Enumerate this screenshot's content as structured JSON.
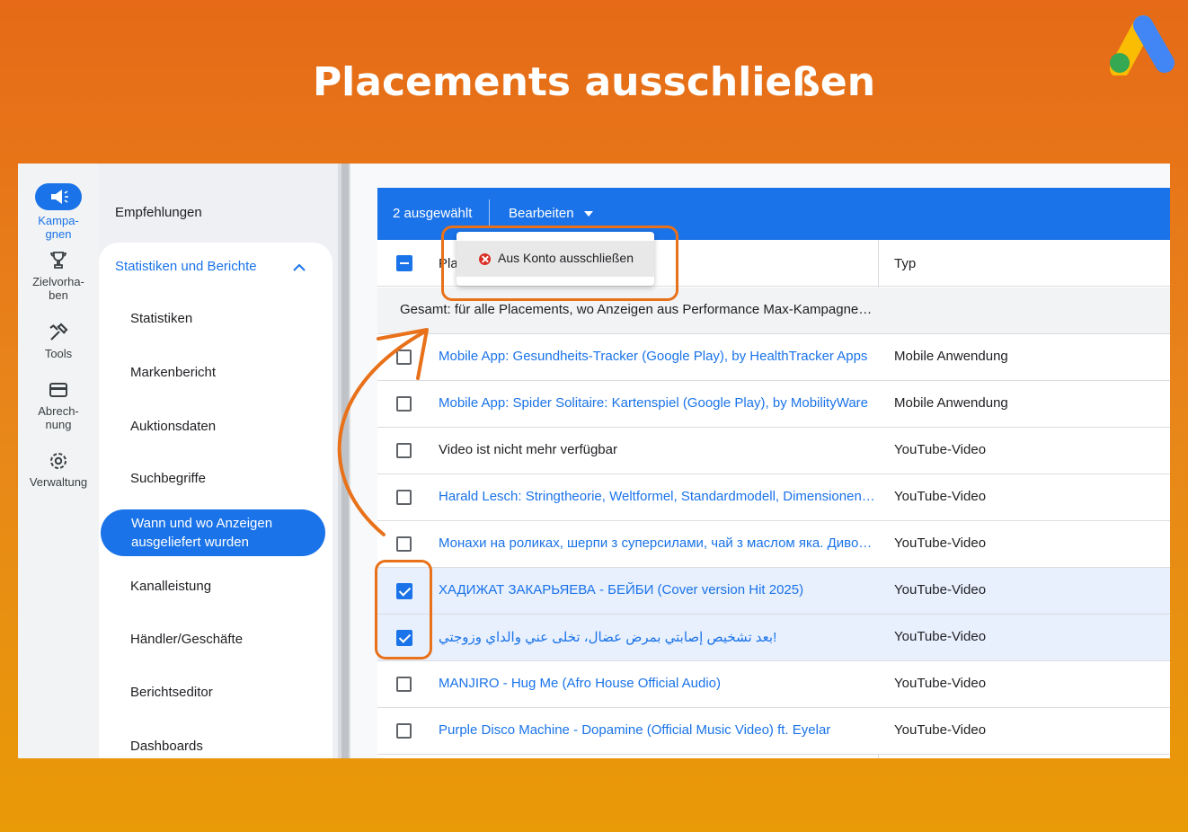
{
  "page_title": "Placements ausschließen",
  "brand_colors": {
    "primary": "#1a73e8",
    "accent_orange": "#e8711a"
  },
  "rail": [
    {
      "label": "Kampa-\ngnen",
      "icon": "megaphone-icon",
      "active": true
    },
    {
      "label": "Zielvorha-\nben",
      "icon": "trophy-icon",
      "active": false
    },
    {
      "label": "Tools",
      "icon": "tools-icon",
      "active": false
    },
    {
      "label": "Abrech-\nnung",
      "icon": "credit-card-icon",
      "active": false
    },
    {
      "label": "Verwaltung",
      "icon": "gear-icon",
      "active": false
    }
  ],
  "nav": {
    "top_item": "Empfehlungen",
    "section": "Statistiken und Berichte",
    "items": [
      "Statistiken",
      "Markenbericht",
      "Auktionsdaten",
      "Suchbegriffe",
      "Wann und wo Anzeigen ausgeliefert wurden",
      "Kanalleistung",
      "Händler/Geschäfte",
      "Berichtseditor",
      "Dashboards"
    ],
    "active_item": "Wann und wo Anzeigen ausgeliefert wurden"
  },
  "toolbar": {
    "selected_count": "2 ausgewählt",
    "edit_label": "Bearbeiten"
  },
  "menu": {
    "item_label": "Aus Konto ausschließen",
    "item_icon": "exclude-icon"
  },
  "table": {
    "header_placement": "Pla",
    "header_type": "Typ",
    "total_text": "Gesamt: für alle Placements, wo Anzeigen aus Performance Max-Kampagnen a...",
    "rows": [
      {
        "placement": "Mobile App: Gesundheits-Tracker (Google Play), by HealthTracker Apps",
        "type": "Mobile Anwendung",
        "link": true,
        "checked": false
      },
      {
        "placement": "Mobile App: Spider Solitaire: Kartenspiel (Google Play), by MobilityWare",
        "type": "Mobile Anwendung",
        "link": true,
        "checked": false
      },
      {
        "placement": "Video ist nicht mehr verfügbar",
        "type": "YouTube-Video",
        "link": false,
        "checked": false
      },
      {
        "placement": "Harald Lesch: Stringtheorie, Weltformel, Standardmodell, Dimensionen • ...",
        "type": "YouTube-Video",
        "link": true,
        "checked": false
      },
      {
        "placement": "Монахи на роликах, шерпи з суперсилами, чай з маслом яка. Дивов...",
        "type": "YouTube-Video",
        "link": true,
        "checked": false
      },
      {
        "placement": "ХАДИЖАТ ЗАКАРЬЯЕВА - БЕЙБИ (Cover version Hit 2025)",
        "type": "YouTube-Video",
        "link": true,
        "checked": true
      },
      {
        "placement": "!بعد تشخيص إصابتي بمرض عضال، تخلى عني والداي وزوجتي",
        "type": "YouTube-Video",
        "link": true,
        "checked": true,
        "rtl": true
      },
      {
        "placement": "MANJIRO - Hug Me (Afro House Official Audio)",
        "type": "YouTube-Video",
        "link": true,
        "checked": false
      },
      {
        "placement": "Purple Disco Machine - Dopamine (Official Music Video) ft. Eyelar",
        "type": "YouTube-Video",
        "link": true,
        "checked": false
      }
    ]
  }
}
